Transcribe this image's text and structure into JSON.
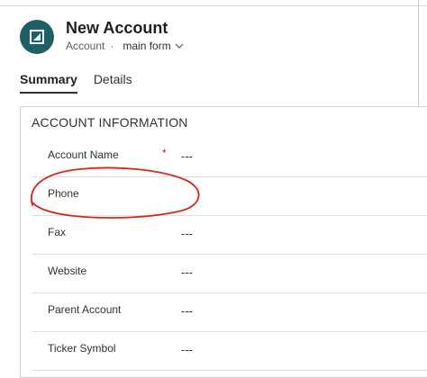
{
  "header": {
    "title": "New Account",
    "entity": "Account",
    "separator": "·",
    "form_name": "main form",
    "avatar_icon": "account-icon"
  },
  "tabs": [
    {
      "label": "Summary",
      "active": true
    },
    {
      "label": "Details",
      "active": false
    }
  ],
  "section": {
    "title": "ACCOUNT INFORMATION",
    "fields": [
      {
        "label": "Account Name",
        "required": "*",
        "value": "---"
      },
      {
        "label": "Phone",
        "value": ""
      },
      {
        "label": "Fax",
        "value": "---"
      },
      {
        "label": "Website",
        "value": "---"
      },
      {
        "label": "Parent Account",
        "value": "---"
      },
      {
        "label": "Ticker Symbol",
        "value": "---"
      }
    ]
  },
  "colors": {
    "accent": "#1e5f68",
    "required": "#a4262c",
    "annotation": "#d9261c"
  }
}
